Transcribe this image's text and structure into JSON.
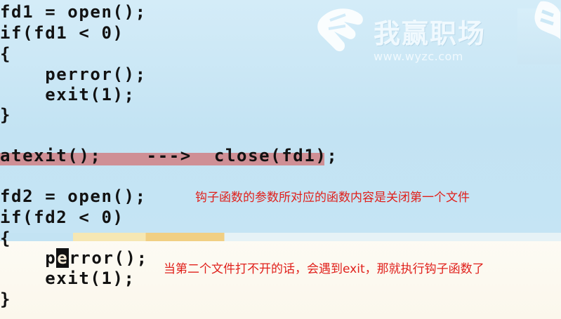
{
  "code": {
    "line1": "fd1 = open();",
    "line2": "if(fd1 < 0)",
    "line3": "{",
    "line4": "    perror();",
    "line5": "    exit(1);",
    "line6": "}",
    "line7": "atexit();    --->  close(fd1);",
    "line8": "fd2 = open();",
    "line9": "if(fd2 < 0)",
    "line10": "{",
    "line11_a": "    p",
    "line11_cursor": "e",
    "line11_b": "rror();",
    "line12": "    exit(1);",
    "line13": "}"
  },
  "captions": {
    "caption1": "钩子函数的参数所对应的函数内容是关闭第一个文件",
    "caption2": "当第二个文件打不开的话，会遇到exit，那就执行钩子函数了"
  },
  "watermark": {
    "name": "我赢职场",
    "url": "www.wyzc.com"
  },
  "colors": {
    "caption": "#e0201b",
    "highlight": "#cf8f95",
    "code": "#121212"
  }
}
